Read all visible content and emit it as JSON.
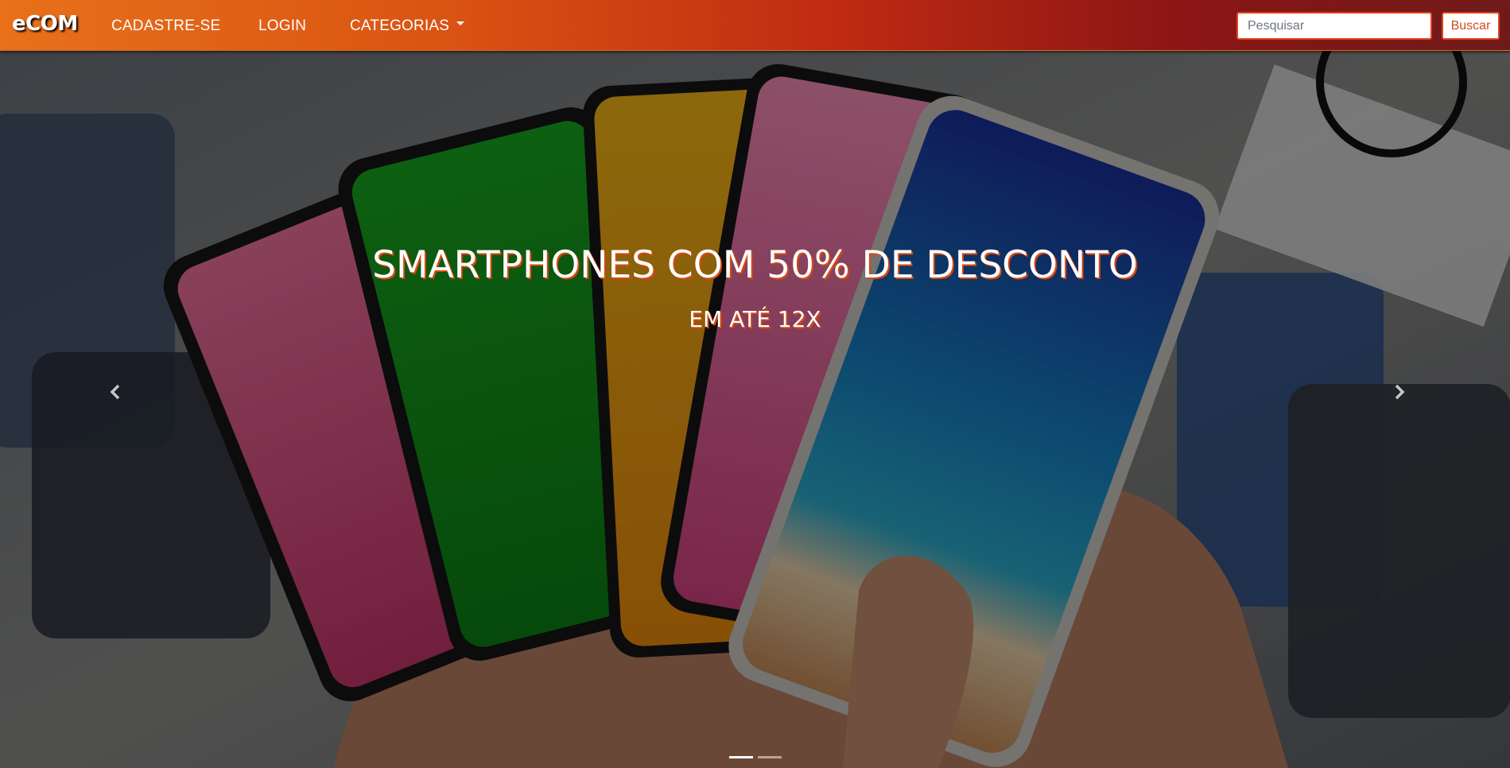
{
  "navbar": {
    "brand": "eCOM",
    "links": [
      {
        "label": "CADASTRE-SE"
      },
      {
        "label": "LOGIN"
      },
      {
        "label": "CATEGORIAS"
      }
    ],
    "search": {
      "placeholder": "Pesquisar",
      "value": "",
      "button_label": "Buscar"
    },
    "colors": {
      "gradient_start": "#e8711a",
      "gradient_end": "#6f1a1a",
      "accent": "#e0441a"
    }
  },
  "carousel": {
    "slide_title": "SMARTPHONES COM 50% DE DESCONTO",
    "slide_subtitle": "EM ATÉ 12X",
    "prev_icon": "chevron-left-icon",
    "next_icon": "chevron-right-icon",
    "indicator_count": 2,
    "active_index": 0
  }
}
